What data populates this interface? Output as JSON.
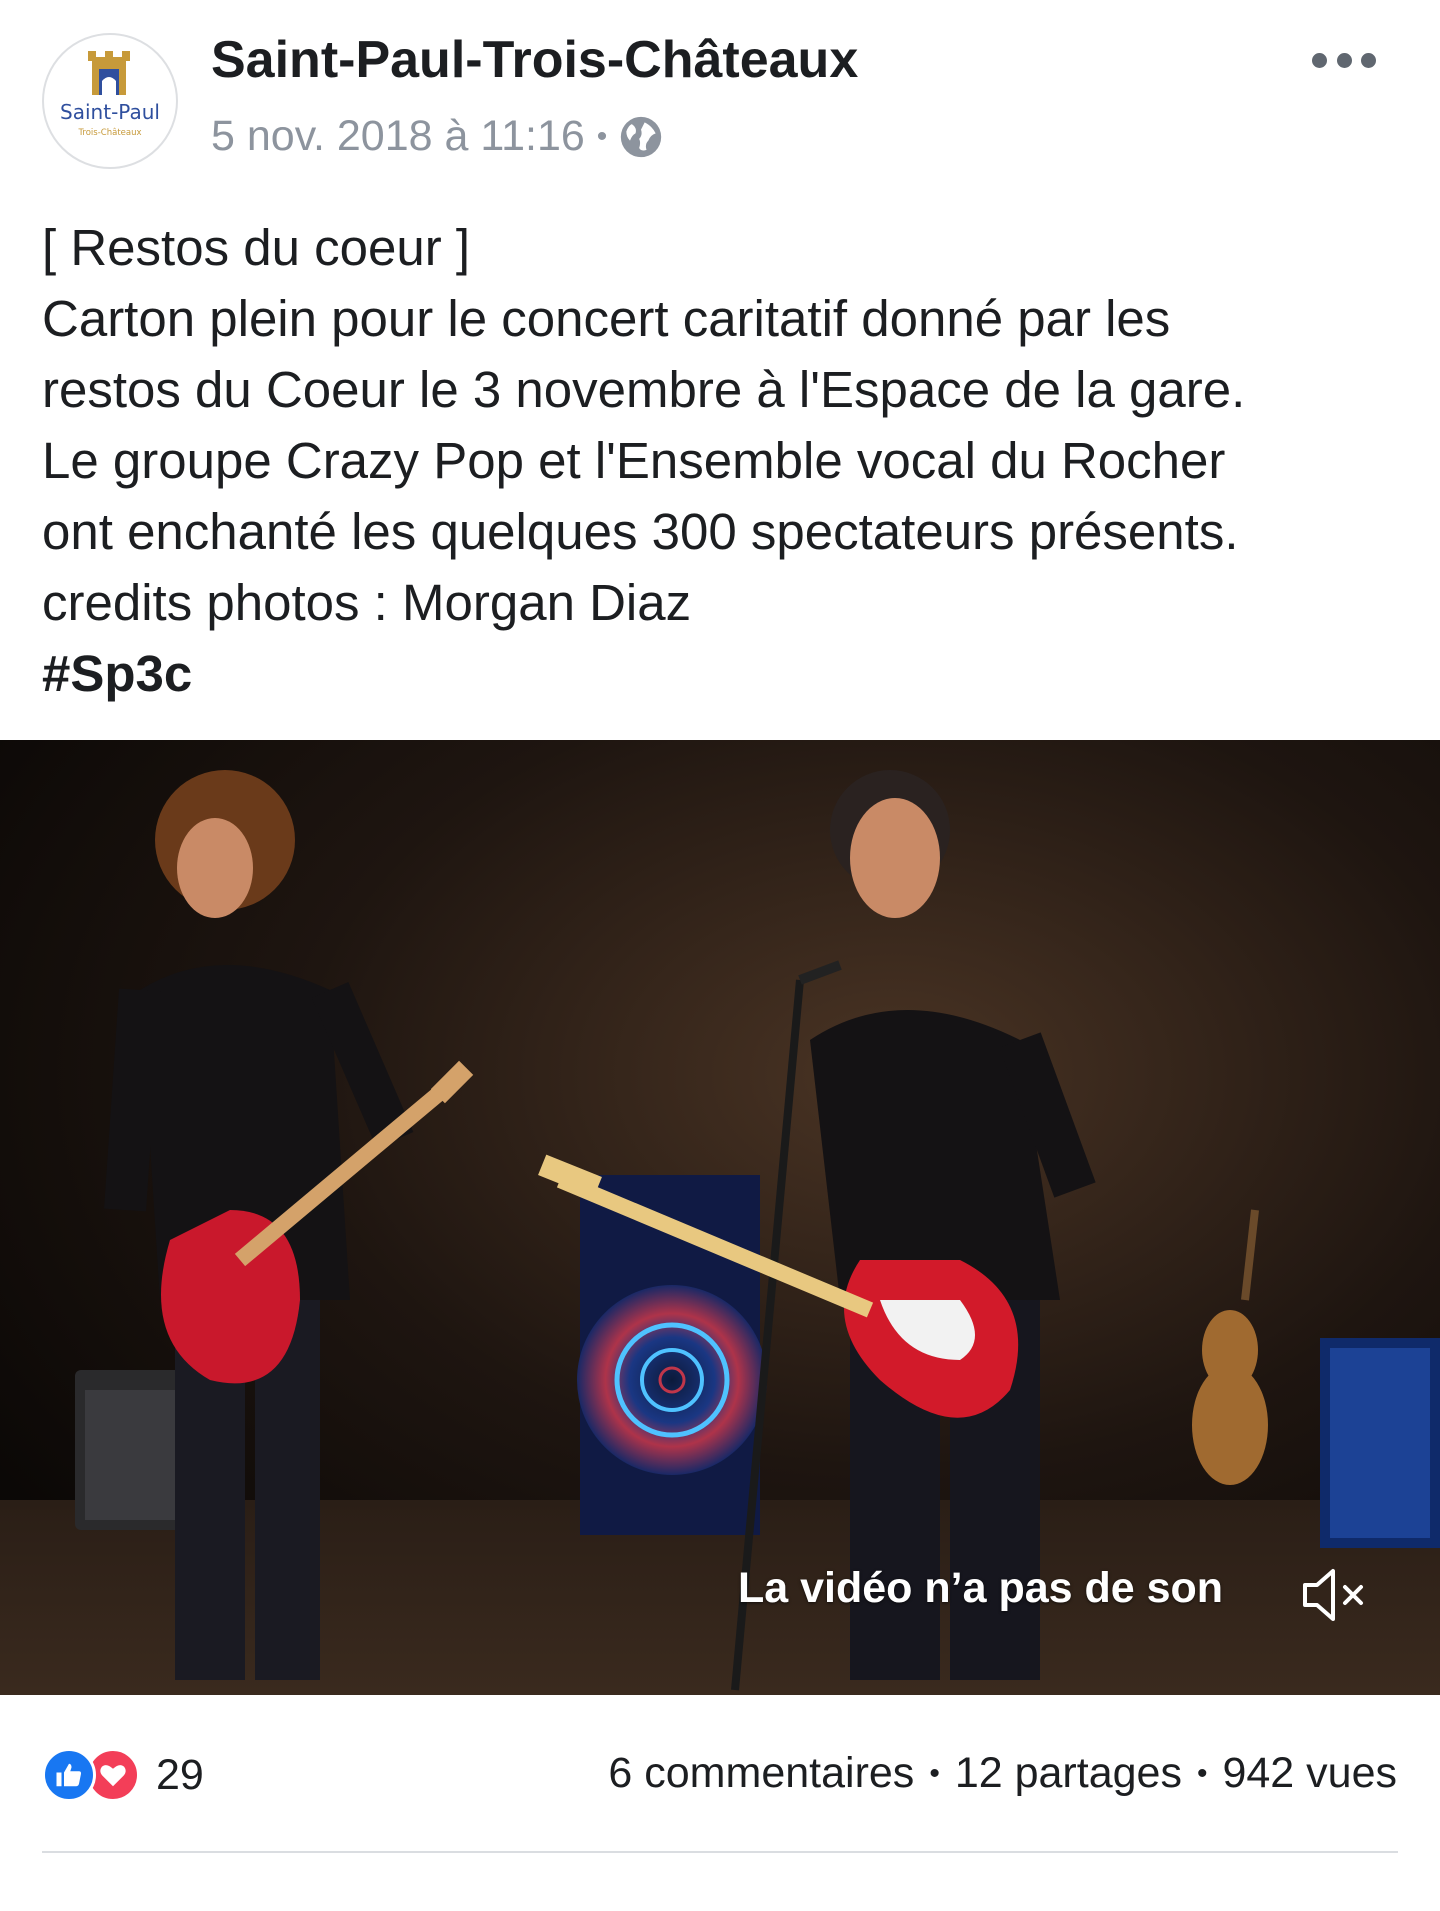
{
  "post": {
    "page_name": "Saint-Paul-Trois-Châteaux",
    "avatar_text": {
      "line1": "Saint-Paul",
      "line2": "Trois-Châteaux"
    },
    "timestamp": "5 nov. 2018 à 11:16",
    "separator": "•",
    "privacy_icon": "globe-icon",
    "more_icon": "more-options-icon",
    "text_lines": [
      "[ Restos du coeur ]",
      "Carton plein pour le concert caritatif donné par les",
      "restos du Coeur le 3 novembre à l'Espace de la gare.",
      "Le groupe Crazy Pop et l'Ensemble vocal du Rocher",
      "ont enchanté les quelques 300 spectateurs présents.",
      "credits photos : Morgan Diaz"
    ],
    "hashtag": "#Sp3c"
  },
  "video": {
    "no_sound_label": "La vidéo n’a pas de son",
    "mute_icon": "speaker-muted-icon"
  },
  "stats": {
    "reaction_icons": [
      "like-icon",
      "love-icon"
    ],
    "reaction_count": "29",
    "comments": "6 commentaires",
    "shares": "12 partages",
    "views": "942 vues",
    "separator": "•"
  },
  "colors": {
    "like": "#1877f2",
    "love": "#f33e58",
    "meta_text": "#8d949e",
    "logo_blue": "#2f4f9e",
    "logo_gold": "#c79a3a"
  }
}
